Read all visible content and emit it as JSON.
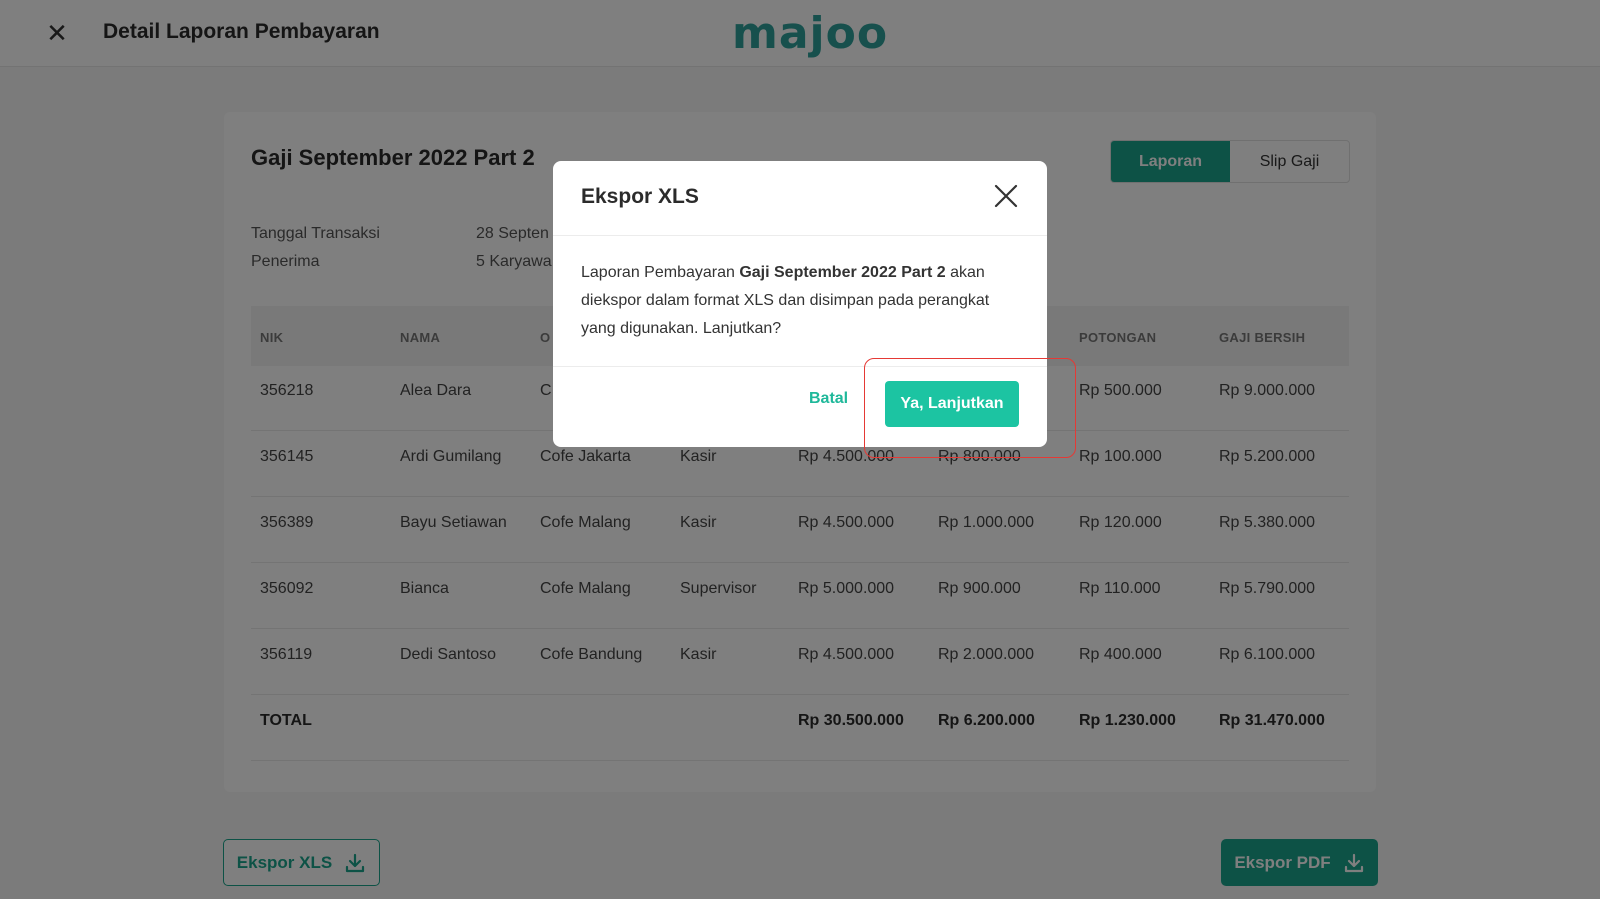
{
  "header": {
    "title": "Detail Laporan Pembayaran",
    "logo_text": "majoo",
    "close_icon": "close-icon"
  },
  "report": {
    "title": "Gaji September 2022 Part 2",
    "tabs": [
      "Laporan",
      "Slip Gaji"
    ],
    "active_tab": "Laporan",
    "info": [
      {
        "label": "Tanggal Transaksi",
        "value": "28 Septen"
      },
      {
        "label": "Penerima",
        "value": "5 Karyawa"
      }
    ]
  },
  "table": {
    "headers": [
      "NIK",
      "NAMA",
      "O",
      "",
      "",
      "",
      "POTONGAN",
      "GAJI BERSIH"
    ],
    "rows": [
      [
        "356218",
        "Alea Dara",
        "C",
        "",
        "",
        "",
        "Rp 500.000",
        "Rp 9.000.000"
      ],
      [
        "356145",
        "Ardi Gumilang",
        "Cofe Jakarta",
        "Kasir",
        "Rp 4.500.000",
        "Rp 800.000",
        "Rp 100.000",
        "Rp 5.200.000"
      ],
      [
        "356389",
        "Bayu Setiawan",
        "Cofe Malang",
        "Kasir",
        "Rp 4.500.000",
        "Rp 1.000.000",
        "Rp 120.000",
        "Rp 5.380.000"
      ],
      [
        "356092",
        "Bianca",
        "Cofe Malang",
        "Supervisor",
        "Rp 5.000.000",
        "Rp 900.000",
        "Rp 110.000",
        "Rp 5.790.000"
      ],
      [
        "356119",
        "Dedi Santoso",
        "Cofe Bandung",
        "Kasir",
        "Rp 4.500.000",
        "Rp 2.000.000",
        "Rp 400.000",
        "Rp 6.100.000"
      ]
    ],
    "total": [
      "TOTAL",
      "",
      "",
      "",
      "Rp 30.500.000",
      "Rp 6.200.000",
      "Rp 1.230.000",
      "Rp 31.470.000"
    ]
  },
  "buttons": {
    "export_xls": "Ekspor XLS",
    "export_pdf": "Ekspor PDF",
    "download_icon": "download-icon"
  },
  "modal": {
    "title": "Ekspor XLS",
    "body_prefix": "Laporan Pembayaran ",
    "body_bold": "Gaji September 2022 Part 2",
    "body_suffix": " akan diekspor dalam format XLS dan disimpan pada perangkat yang digunakan. Lanjutkan?",
    "cancel_label": "Batal",
    "confirm_label": "Ya, Lanjutkan"
  },
  "colors": {
    "accent": "#1aa58c",
    "confirm": "#1cc4a2",
    "highlight": "#e53935"
  }
}
